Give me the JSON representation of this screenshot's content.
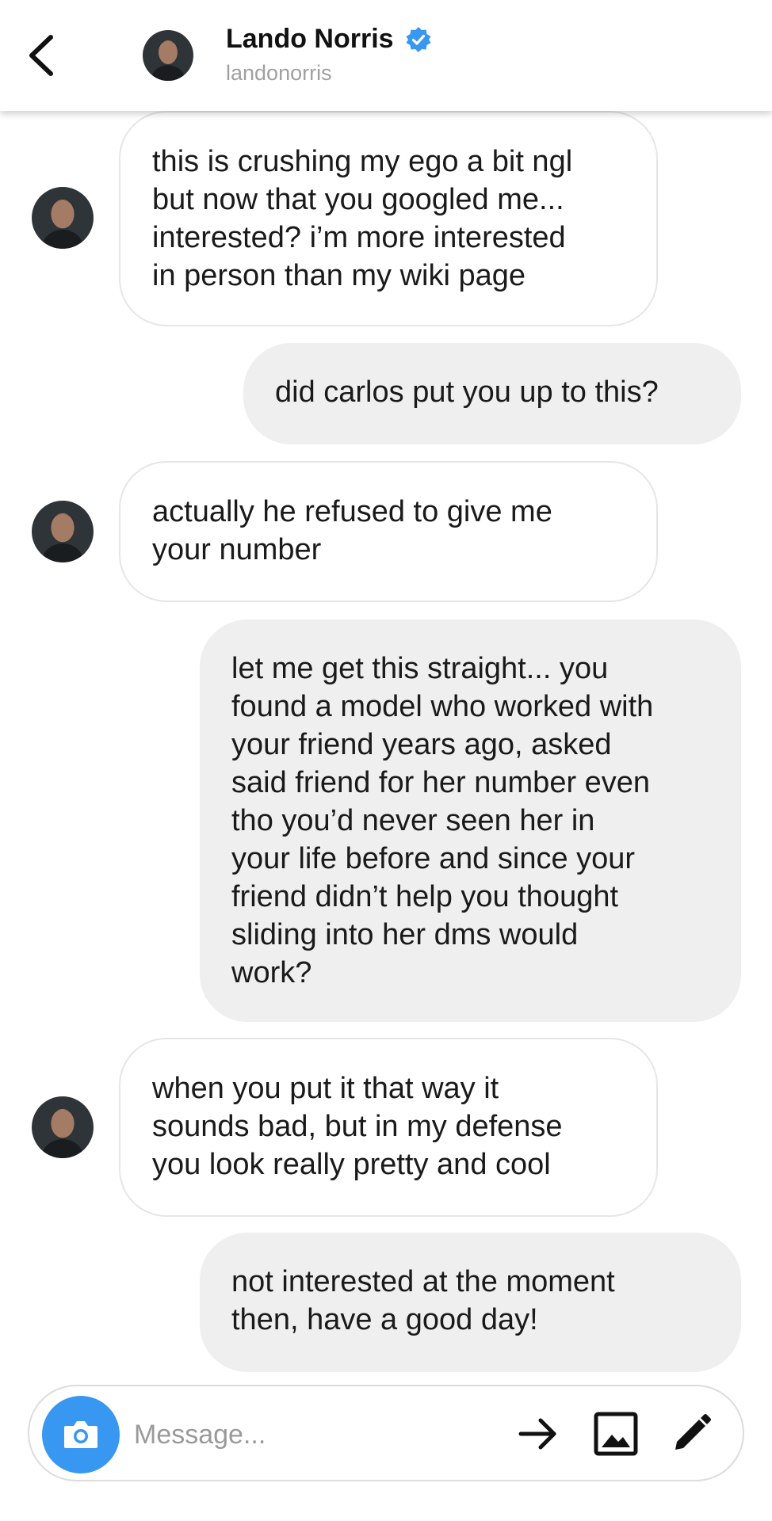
{
  "header": {
    "name": "Lando Norris",
    "handle": "landonorris",
    "back_icon": "chevron-left-icon",
    "verified_icon": "verified-badge-icon",
    "verified_color": "#3897f0"
  },
  "messages": [
    {
      "from": "them",
      "text": "this is crushing my ego a bit ngl\nbut now that you googled me...\ninterested? i’m more interested\nin person than my wiki page"
    },
    {
      "from": "me",
      "text": "did carlos put you up to this?"
    },
    {
      "from": "them",
      "text": "actually he refused to give me\nyour number"
    },
    {
      "from": "me",
      "text": "let me get this straight... you\nfound a model who worked with\nyour friend years ago, asked\nsaid friend for her number even\ntho you’d never seen her in\nyour life before and since your\nfriend didn’t help you thought\nsliding into her dms would\nwork?"
    },
    {
      "from": "them",
      "text": "when you put it that way it\nsounds bad, but in my defense\nyou look really pretty and cool"
    },
    {
      "from": "me",
      "text": "not interested at the moment\nthen, have a good day!"
    }
  ],
  "composer": {
    "placeholder": "Message...",
    "camera_icon": "camera-icon",
    "send_icon": "arrow-right-icon",
    "gallery_icon": "image-icon",
    "sticker_icon": "pencil-icon",
    "accent_color": "#3897f0"
  }
}
